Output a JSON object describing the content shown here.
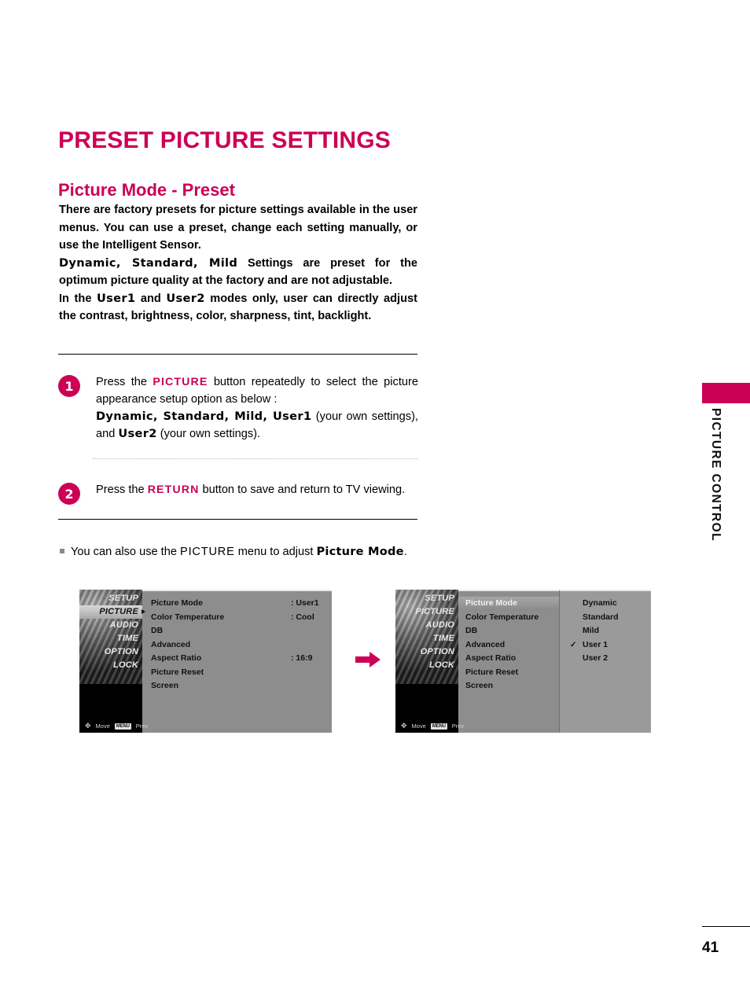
{
  "document": {
    "page_number": "41",
    "side_tab_label": "PICTURE CONTROL",
    "accent_color": "#CC0055"
  },
  "headings": {
    "title": "PRESET PICTURE SETTINGS",
    "subtitle": "Picture Mode - Preset"
  },
  "intro": {
    "para1": "There are factory presets for picture settings available in the user menus. You can use a preset, change each setting manually, or use the Intelligent Sensor.",
    "para2_modes": "Dynamic, Standard, Mild",
    "para2_rest": " Settings are preset for the optimum picture quality at the factory and are not adjustable.",
    "para3_pre": "In the ",
    "para3_user1": "User1",
    "para3_mid": " and ",
    "para3_user2": "User2",
    "para3_rest": " modes only, user can directly adjust the contrast, brightness, color, sharpness, tint, backlight."
  },
  "steps": [
    {
      "number": "1",
      "line1_pre": "Press the ",
      "line1_key": "PICTURE",
      "line1_post": " button repeatedly to select the picture appearance setup option as below :",
      "line2_modes": "Dynamic, Standard, Mild, User1",
      "line2_note1": "  (your own settings),",
      "line2_and": "and ",
      "line2_user2": "User2",
      "line2_note2": " (your own settings)."
    },
    {
      "number": "2",
      "line1_pre": "Press the ",
      "line1_key": "RETURN",
      "line1_post": " button to save and return to TV viewing."
    }
  ],
  "note": {
    "pre": "You can also use the ",
    "key": "PICTURE",
    "mid": " menu to adjust ",
    "bold": "Picture Mode",
    "post": "."
  },
  "osd": {
    "sidebar_items": [
      {
        "label": "SETUP",
        "selected": false
      },
      {
        "label": "PICTURE",
        "selected": true
      },
      {
        "label": "AUDIO",
        "selected": false
      },
      {
        "label": "TIME",
        "selected": false
      },
      {
        "label": "OPTION",
        "selected": false
      },
      {
        "label": "LOCK",
        "selected": false
      }
    ],
    "sidebar_items_right": [
      {
        "label": "SETUP",
        "selected": false
      },
      {
        "label": "PICTURE",
        "selected": false
      },
      {
        "label": "AUDIO",
        "selected": false
      },
      {
        "label": "TIME",
        "selected": false
      },
      {
        "label": "OPTION",
        "selected": false
      },
      {
        "label": "LOCK",
        "selected": false
      }
    ],
    "hint_move": "Move",
    "hint_prev": "Prev",
    "hint_menu_key": "MENU",
    "left_panel": {
      "rows": [
        {
          "label": "Picture Mode",
          "value": ": User1"
        },
        {
          "label": "Color Temperature",
          "value": ": Cool"
        },
        {
          "label": "DB",
          "value": ""
        },
        {
          "label": "Advanced",
          "value": ""
        },
        {
          "label": "Aspect Ratio",
          "value": ": 16:9"
        },
        {
          "label": "Picture Reset",
          "value": ""
        },
        {
          "label": "Screen",
          "value": ""
        }
      ]
    },
    "right_panel": {
      "rows": [
        {
          "label": "Picture Mode",
          "highlighted": true
        },
        {
          "label": "Color Temperature",
          "highlighted": false
        },
        {
          "label": "DB",
          "highlighted": false
        },
        {
          "label": "Advanced",
          "highlighted": false
        },
        {
          "label": "Aspect Ratio",
          "highlighted": false
        },
        {
          "label": "Picture Reset",
          "highlighted": false
        },
        {
          "label": "Screen",
          "highlighted": false
        }
      ],
      "submenu": [
        {
          "label": "Dynamic",
          "checked": false
        },
        {
          "label": "Standard",
          "checked": false
        },
        {
          "label": "Mild",
          "checked": false
        },
        {
          "label": "User 1",
          "checked": true
        },
        {
          "label": "User 2",
          "checked": false
        }
      ],
      "check_glyph": "✓"
    }
  }
}
